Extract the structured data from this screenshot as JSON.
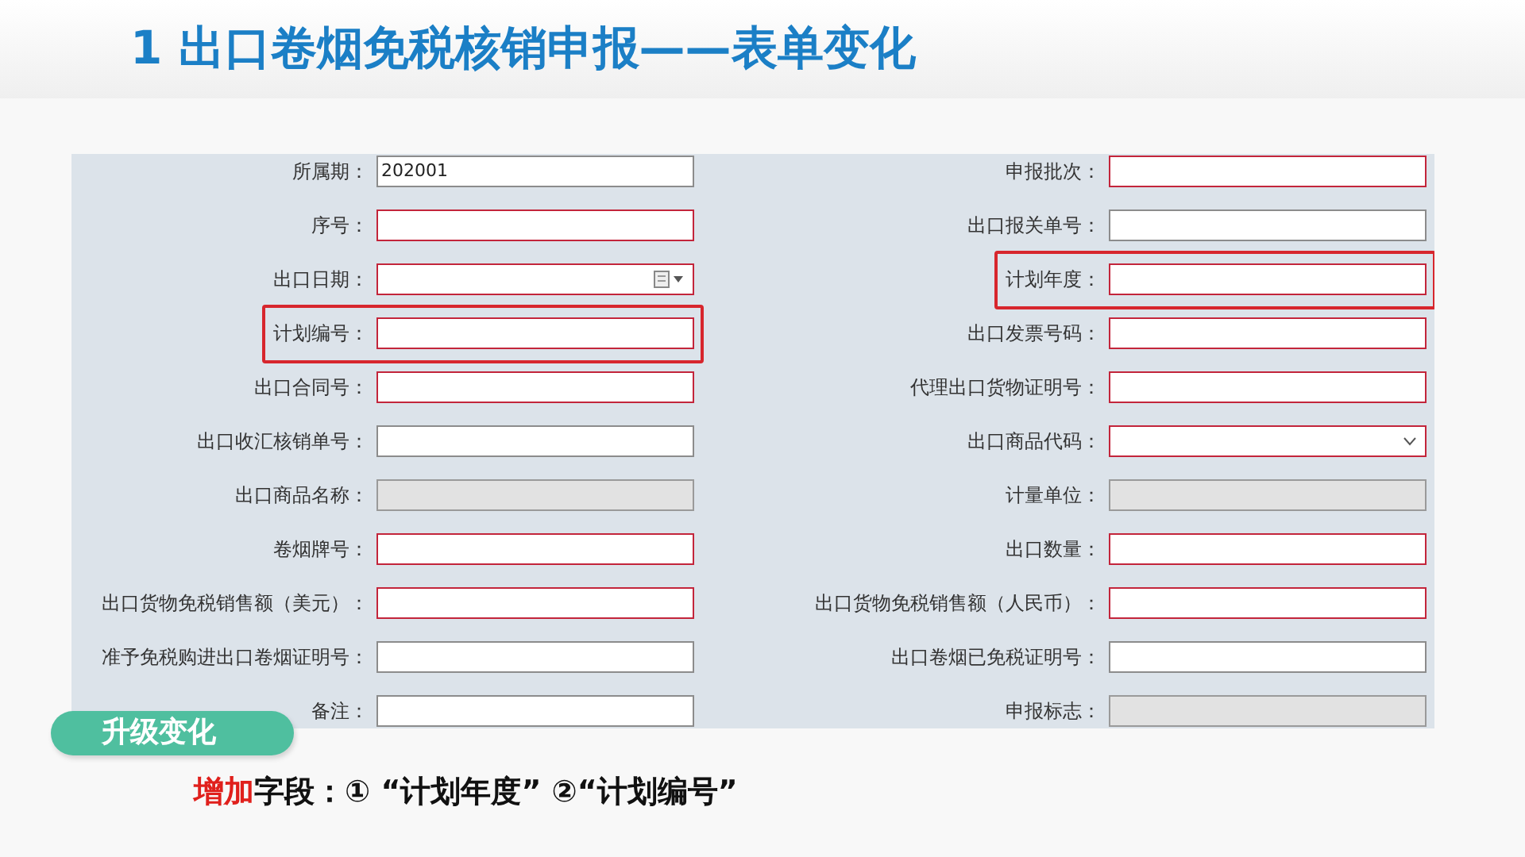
{
  "title": "1 出口卷烟免税核销申报——表单变化",
  "form": {
    "rows": [
      {
        "left": {
          "label": "所属期：",
          "kind": "text",
          "required": false,
          "disabled": false,
          "highlighted": false,
          "value": "202001"
        },
        "right": {
          "label": "申报批次：",
          "kind": "text",
          "required": true,
          "disabled": false,
          "highlighted": false
        }
      },
      {
        "left": {
          "label": "序号：",
          "kind": "text",
          "required": true,
          "disabled": false,
          "highlighted": false
        },
        "right": {
          "label": "出口报关单号：",
          "kind": "text",
          "required": false,
          "disabled": false,
          "highlighted": false
        }
      },
      {
        "left": {
          "label": "出口日期：",
          "kind": "date",
          "required": true,
          "disabled": false,
          "highlighted": false
        },
        "right": {
          "label": "计划年度：",
          "kind": "text",
          "required": true,
          "disabled": false,
          "highlighted": true
        }
      },
      {
        "left": {
          "label": "计划编号：",
          "kind": "text",
          "required": true,
          "disabled": false,
          "highlighted": true
        },
        "right": {
          "label": "出口发票号码：",
          "kind": "text",
          "required": true,
          "disabled": false,
          "highlighted": false
        }
      },
      {
        "left": {
          "label": "出口合同号：",
          "kind": "text",
          "required": true,
          "disabled": false,
          "highlighted": false
        },
        "right": {
          "label": "代理出口货物证明号：",
          "kind": "text",
          "required": true,
          "disabled": false,
          "highlighted": false
        }
      },
      {
        "left": {
          "label": "出口收汇核销单号：",
          "kind": "text",
          "required": false,
          "disabled": false,
          "highlighted": false
        },
        "right": {
          "label": "出口商品代码：",
          "kind": "select",
          "required": true,
          "disabled": false,
          "highlighted": false
        }
      },
      {
        "left": {
          "label": "出口商品名称：",
          "kind": "text",
          "required": false,
          "disabled": true,
          "highlighted": false
        },
        "right": {
          "label": "计量单位：",
          "kind": "text",
          "required": false,
          "disabled": true,
          "highlighted": false
        }
      },
      {
        "left": {
          "label": "卷烟牌号：",
          "kind": "text",
          "required": true,
          "disabled": false,
          "highlighted": false
        },
        "right": {
          "label": "出口数量：",
          "kind": "text",
          "required": true,
          "disabled": false,
          "highlighted": false
        }
      },
      {
        "left": {
          "label": "出口货物免税销售额（美元）：",
          "kind": "text",
          "required": true,
          "disabled": false,
          "highlighted": false
        },
        "right": {
          "label": "出口货物免税销售额（人民币）：",
          "kind": "text",
          "required": true,
          "disabled": false,
          "highlighted": false
        }
      },
      {
        "left": {
          "label": "准予免税购进出口卷烟证明号：",
          "kind": "text",
          "required": false,
          "disabled": false,
          "highlighted": false
        },
        "right": {
          "label": "出口卷烟已免税证明号：",
          "kind": "text",
          "required": false,
          "disabled": false,
          "highlighted": false
        }
      },
      {
        "left": {
          "label": "备注：",
          "kind": "text",
          "required": false,
          "disabled": false,
          "highlighted": false
        },
        "right": {
          "label": "申报标志：",
          "kind": "text",
          "required": false,
          "disabled": true,
          "highlighted": false
        }
      }
    ]
  },
  "badge": "升级变化",
  "note": {
    "highlight": "增加",
    "text": "字段：① “计划年度” ②“计划编号”"
  }
}
